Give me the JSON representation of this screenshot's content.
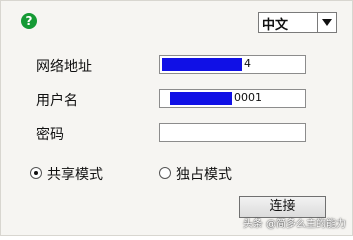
{
  "dialog": {
    "help_icon_glyph": "?",
    "language": {
      "selected": "中文"
    },
    "fields": {
      "network_address_label": "网络地址",
      "network_address_value_visible": "4",
      "username_label": "用户名",
      "username_value_visible": "0001",
      "password_label": "密码",
      "password_value": ""
    },
    "modes": {
      "shared_label": "共享模式",
      "exclusive_label": "独占模式",
      "selected": "shared"
    },
    "connect_label": "连接"
  },
  "watermark": "头条 @简多么主的能力",
  "colors": {
    "help_icon": "#159a35",
    "redaction": "#1010e6",
    "dialog_bg": "#f6f5f2"
  }
}
